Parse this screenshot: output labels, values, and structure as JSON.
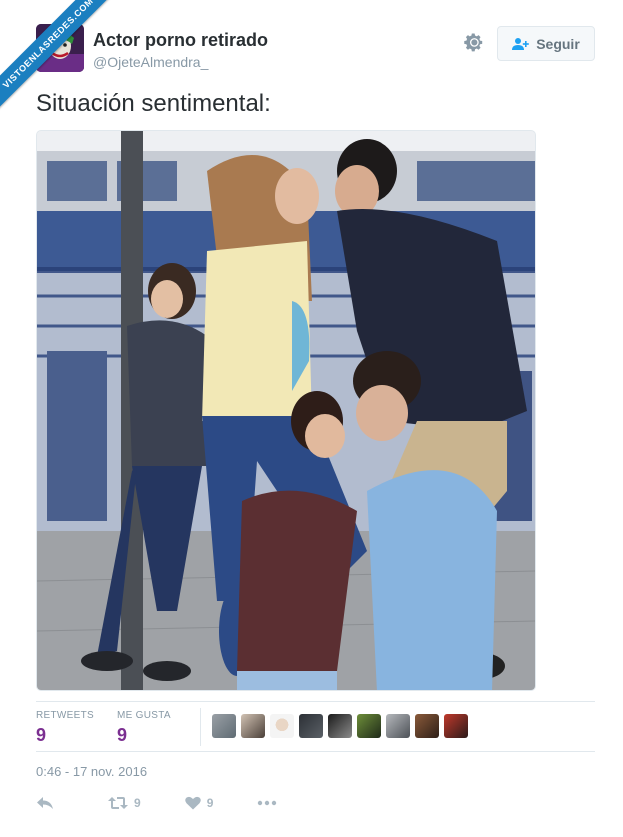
{
  "watermark": {
    "text": "VISTOENLASREDES.COM"
  },
  "user": {
    "display_name": "Actor porno retirado",
    "handle": "@OjeteAlmendra_"
  },
  "header": {
    "follow_label": "Seguir"
  },
  "tweet": {
    "text": "Situación sentimental:"
  },
  "stats": {
    "retweets_label": "RETWEETS",
    "retweets_count": "9",
    "likes_label": "ME GUSTA",
    "likes_count": "9"
  },
  "likers_count": 9,
  "timestamp": "0:46 - 17 nov. 2016",
  "actions": {
    "retweet_count": "9",
    "like_count": "9"
  },
  "colors": {
    "count_purple": "#7b2f91",
    "muted_gray": "#8899a6",
    "action_gray": "#aab8c2"
  }
}
